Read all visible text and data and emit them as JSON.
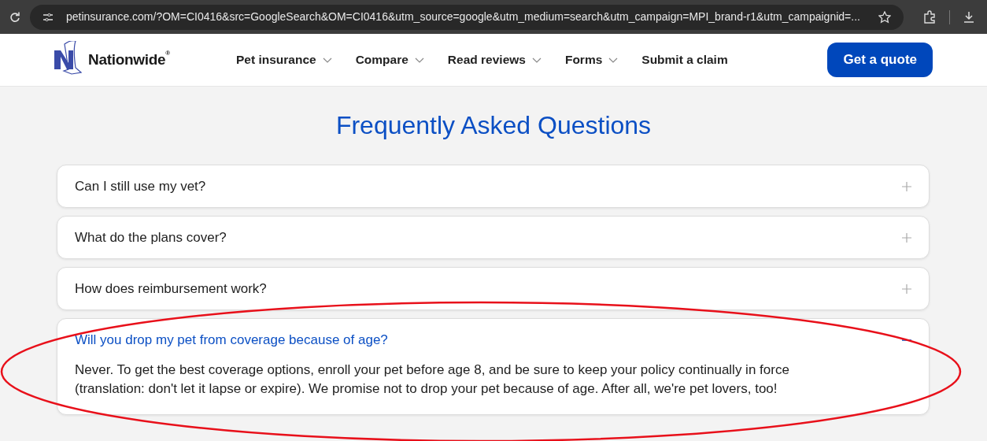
{
  "browser": {
    "url": "petinsurance.com/?OM=CI0416&src=GoogleSearch&OM=CI0416&utm_source=google&utm_medium=search&utm_campaign=MPI_brand-r1&utm_campaignid=..."
  },
  "header": {
    "logo": "Nationwide",
    "logo_mark": "®",
    "nav": [
      {
        "label": "Pet insurance",
        "dropdown": true
      },
      {
        "label": "Compare",
        "dropdown": true
      },
      {
        "label": "Read reviews",
        "dropdown": true
      },
      {
        "label": "Forms",
        "dropdown": true
      },
      {
        "label": "Submit a claim",
        "dropdown": false
      }
    ],
    "cta": "Get a quote"
  },
  "faq": {
    "title": "Frequently Asked Questions",
    "items": [
      {
        "question": "Can I still use my vet?",
        "expanded": false
      },
      {
        "question": "What do the plans cover?",
        "expanded": false
      },
      {
        "question": "How does reimbursement work?",
        "expanded": false
      },
      {
        "question": "Will you drop my pet from coverage because of age?",
        "expanded": true,
        "answer": "Never. To get the best coverage options, enroll your pet before age 8, and be sure to keep your policy continually in force (translation: don't let it lapse or expire). We promise not to drop your pet because of age. After all, we're pet lovers, too!"
      }
    ]
  },
  "annotation_ellipse": true
}
